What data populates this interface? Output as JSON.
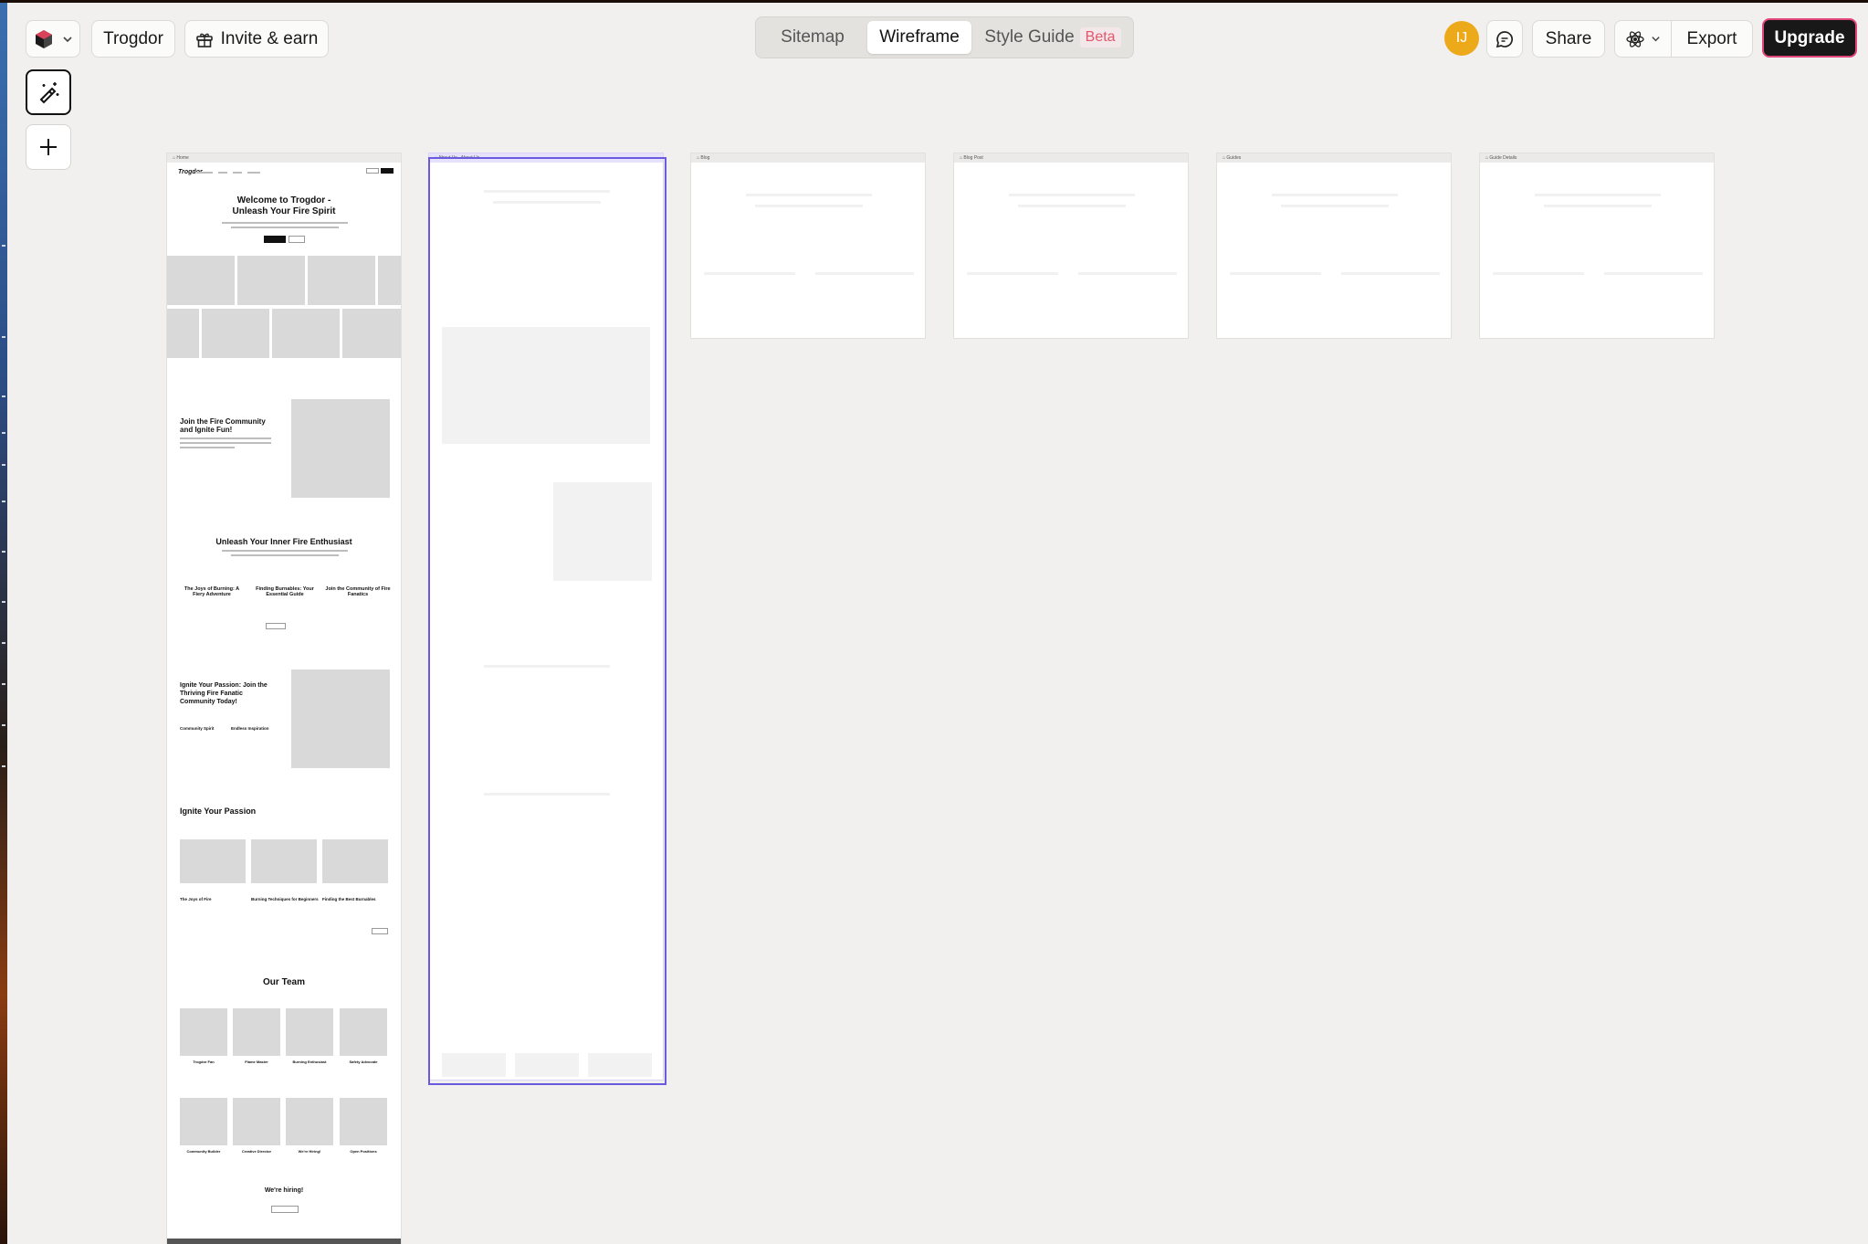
{
  "toolbar": {
    "project_name": "Trogdor",
    "invite_label": "Invite & earn",
    "avatar_initials": "IJ",
    "share_label": "Share",
    "export_label": "Export",
    "upgrade_label": "Upgrade"
  },
  "view_tabs": [
    {
      "label": "Sitemap",
      "active": false
    },
    {
      "label": "Wireframe",
      "active": true
    },
    {
      "label": "Style Guide",
      "active": false,
      "badge": "Beta"
    }
  ],
  "colors": {
    "accent": "#6a5ae0",
    "avatar": "#ecaa1a",
    "upgrade_border": "#e0467a",
    "beta": "#e3566c"
  },
  "home": {
    "tab": "Home",
    "brand": "Trogdor",
    "hero_title_1": "Welcome to Trogdor -",
    "hero_title_2": "Unleash Your Fire Spirit",
    "join_title_1": "Join the Fire Community",
    "join_title_2": "and Ignite Fun!",
    "unleash_title": "Unleash Your Inner Fire Enthusiast",
    "features": [
      "The Joys of Burning: A Fiery Adventure",
      "Finding Burnables: Your Essential Guide",
      "Join the Community of Fire Fanatics"
    ],
    "ignite_title_1": "Ignite Your Passion: Join the",
    "ignite_title_2": "Thriving Fire Fanatic",
    "ignite_title_3": "Community Today!",
    "ignite_cols": [
      "Community Spirit",
      "Endless Inspiration"
    ],
    "blog_title": "Ignite Your Passion",
    "blog_posts": [
      "The Joys of Fire",
      "Burning Techniques for Beginners",
      "Finding the Best Burnables"
    ],
    "team_title": "Our Team",
    "team_roles": [
      "Trogdor Fan",
      "Flame Master",
      "Burning Enthusiast",
      "Safety Advocate",
      "Community Builder",
      "Creative Director",
      "We're Hiring!",
      "Open Positions"
    ],
    "hiring_title": "We're hiring!"
  },
  "about": {
    "tab": "About Us",
    "tab2": "About Us"
  },
  "other_pages": [
    {
      "tab": "Blog"
    },
    {
      "tab": "Blog Post"
    },
    {
      "tab": "Guides"
    },
    {
      "tab": "Guide Details"
    }
  ],
  "icons": [
    "logo-cube-icon",
    "chevron-down-icon",
    "gift-icon",
    "comment-icon",
    "react-atom-icon",
    "magic-wand-icon",
    "plus-icon",
    "image-placeholder-icon"
  ]
}
